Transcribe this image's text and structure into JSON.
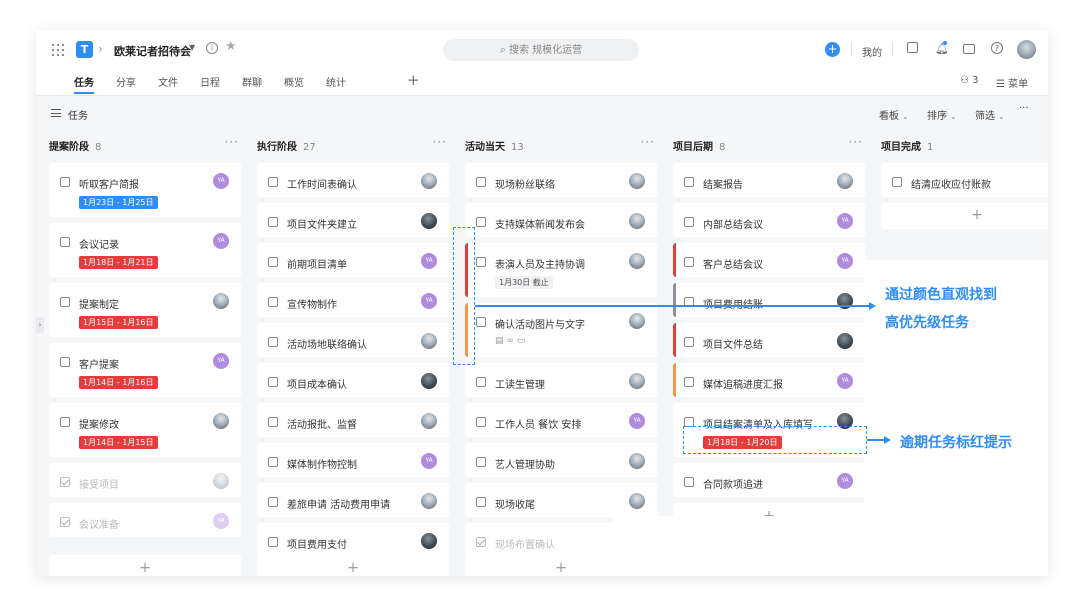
{
  "app": {
    "project_title": "欧莱记者招待会",
    "search_placeholder": "搜索 规模化运营",
    "mine_label": "我的",
    "members_count": "3",
    "menu_label": "菜单",
    "logo_letter": "T"
  },
  "tabs": [
    {
      "label": "任务",
      "active": true
    },
    {
      "label": "分享",
      "active": false
    },
    {
      "label": "文件",
      "active": false
    },
    {
      "label": "日程",
      "active": false
    },
    {
      "label": "群聊",
      "active": false
    },
    {
      "label": "概览",
      "active": false
    },
    {
      "label": "统计",
      "active": false
    }
  ],
  "subbar": {
    "title": "任务",
    "view_label": "看板",
    "sort_label": "排序",
    "filter_label": "筛选",
    "more": "···"
  },
  "columns": [
    {
      "title": "提案阶段",
      "count": "8",
      "cards": [
        {
          "label": "听取客户简报",
          "avatar": "YA",
          "date": "1月23日 - 1月25日",
          "date_color": "blue"
        },
        {
          "label": "会议记录",
          "avatar": "YA",
          "date": "1月18日 - 1月21日",
          "date_color": "red"
        },
        {
          "label": "提案制定",
          "avatar": "photo",
          "date": "1月15日 - 1月16日",
          "date_color": "red"
        },
        {
          "label": "客户提案",
          "avatar": "YA",
          "date": "1月14日 - 1月16日",
          "date_color": "red"
        },
        {
          "label": "提案修改",
          "avatar": "photo",
          "date": "1月14日 - 1月15日",
          "date_color": "red"
        },
        {
          "label": "接受项目",
          "avatar": "photo",
          "done": true
        },
        {
          "label": "会议准备",
          "avatar": "YA",
          "done": true
        }
      ]
    },
    {
      "title": "执行阶段",
      "count": "27",
      "cards": [
        {
          "label": "工作时间表确认",
          "avatar": "photo"
        },
        {
          "label": "项目文件夹建立",
          "avatar": "dark"
        },
        {
          "label": "前期项目清单",
          "avatar": "YA"
        },
        {
          "label": "宣传物制作",
          "avatar": "YA"
        },
        {
          "label": "活动场地联络确认",
          "avatar": "photo"
        },
        {
          "label": "项目成本确认",
          "avatar": "dark"
        },
        {
          "label": "活动报批、监督",
          "avatar": "photo"
        },
        {
          "label": "媒体制作物控制",
          "avatar": "YA"
        },
        {
          "label": "差旅申请 活动费用申请",
          "avatar": "photo"
        },
        {
          "label": "项目费用支付",
          "avatar": "dark"
        }
      ]
    },
    {
      "title": "活动当天",
      "count": "13",
      "cards": [
        {
          "label": "现场粉丝联络",
          "avatar": "photo"
        },
        {
          "label": "支持媒体新闻发布会",
          "avatar": "photo"
        },
        {
          "label": "表演人员及主持协调",
          "avatar": "photo",
          "date": "1月30日 截止",
          "date_color": "grey",
          "stripe": "red"
        },
        {
          "label": "确认活动图片与文字",
          "avatar": "photo",
          "stripe": "orange",
          "meta": "▤   ∞   ▭"
        },
        {
          "label": "工读生管理",
          "avatar": "photo"
        },
        {
          "label": "工作人员 餐饮 安排",
          "avatar": "YA"
        },
        {
          "label": "艺人管理协助",
          "avatar": "photo"
        },
        {
          "label": "现场收尾",
          "avatar": "photo"
        },
        {
          "label": "现场布置确认",
          "avatar": "photo",
          "done": true
        }
      ]
    },
    {
      "title": "项目后期",
      "count": "8",
      "cards": [
        {
          "label": "结案报告",
          "avatar": "photo"
        },
        {
          "label": "内部总结会议",
          "avatar": "YA"
        },
        {
          "label": "客户总结会议",
          "avatar": "YA",
          "stripe": "red"
        },
        {
          "label": "项目费用结账",
          "avatar": "dark",
          "stripe": "grey"
        },
        {
          "label": "项目文件总结",
          "avatar": "dark",
          "stripe": "red"
        },
        {
          "label": "媒体追稿进度汇报",
          "avatar": "YA",
          "stripe": "orange"
        },
        {
          "label": "项目结案清单及入库填写",
          "avatar": "dark",
          "date": "1月18日 - 1月20日",
          "date_color": "red"
        },
        {
          "label": "合同款项追进",
          "avatar": "YA"
        }
      ]
    },
    {
      "title": "项目完成",
      "count": "1",
      "cards": [
        {
          "label": "结清应收应付账款",
          "avatar": "photo"
        }
      ]
    }
  ],
  "annotations": {
    "color_hint_line1": "通过颜色直观找到",
    "color_hint_line2": "高优先级任务",
    "overdue_hint": "逾期任务标红提示"
  },
  "colors": {
    "accent": "#2e8ef5",
    "urgent_red": "#e23c3c",
    "priority_orange": "#f29a4a",
    "avatar_purple": "#b08be0"
  }
}
